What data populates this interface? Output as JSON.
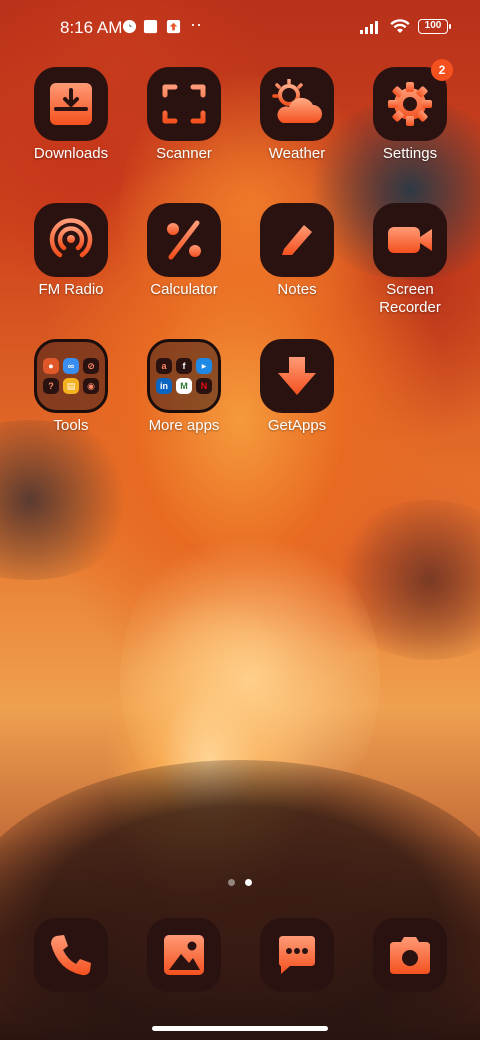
{
  "status_bar": {
    "time": "8:16 AM",
    "battery": "100",
    "overflow": "··"
  },
  "apps": {
    "row1": [
      "Downloads",
      "Scanner",
      "Weather",
      "Settings"
    ],
    "row2": [
      "FM Radio",
      "Calculator",
      "Notes",
      "Screen\nRecorder"
    ],
    "row3": [
      "Tools",
      "More apps",
      "GetApps"
    ]
  },
  "settings_badge": "2",
  "page_indicator": {
    "pages": 2,
    "active": 2
  },
  "dock": [
    "phone-icon",
    "gallery-icon",
    "messages-icon",
    "camera-icon"
  ],
  "colors": {
    "icon_bg": "#2a1211",
    "icon_accent_top": "#ff8a65",
    "icon_accent_bottom": "#f4511e",
    "badge": "#f4511e"
  }
}
